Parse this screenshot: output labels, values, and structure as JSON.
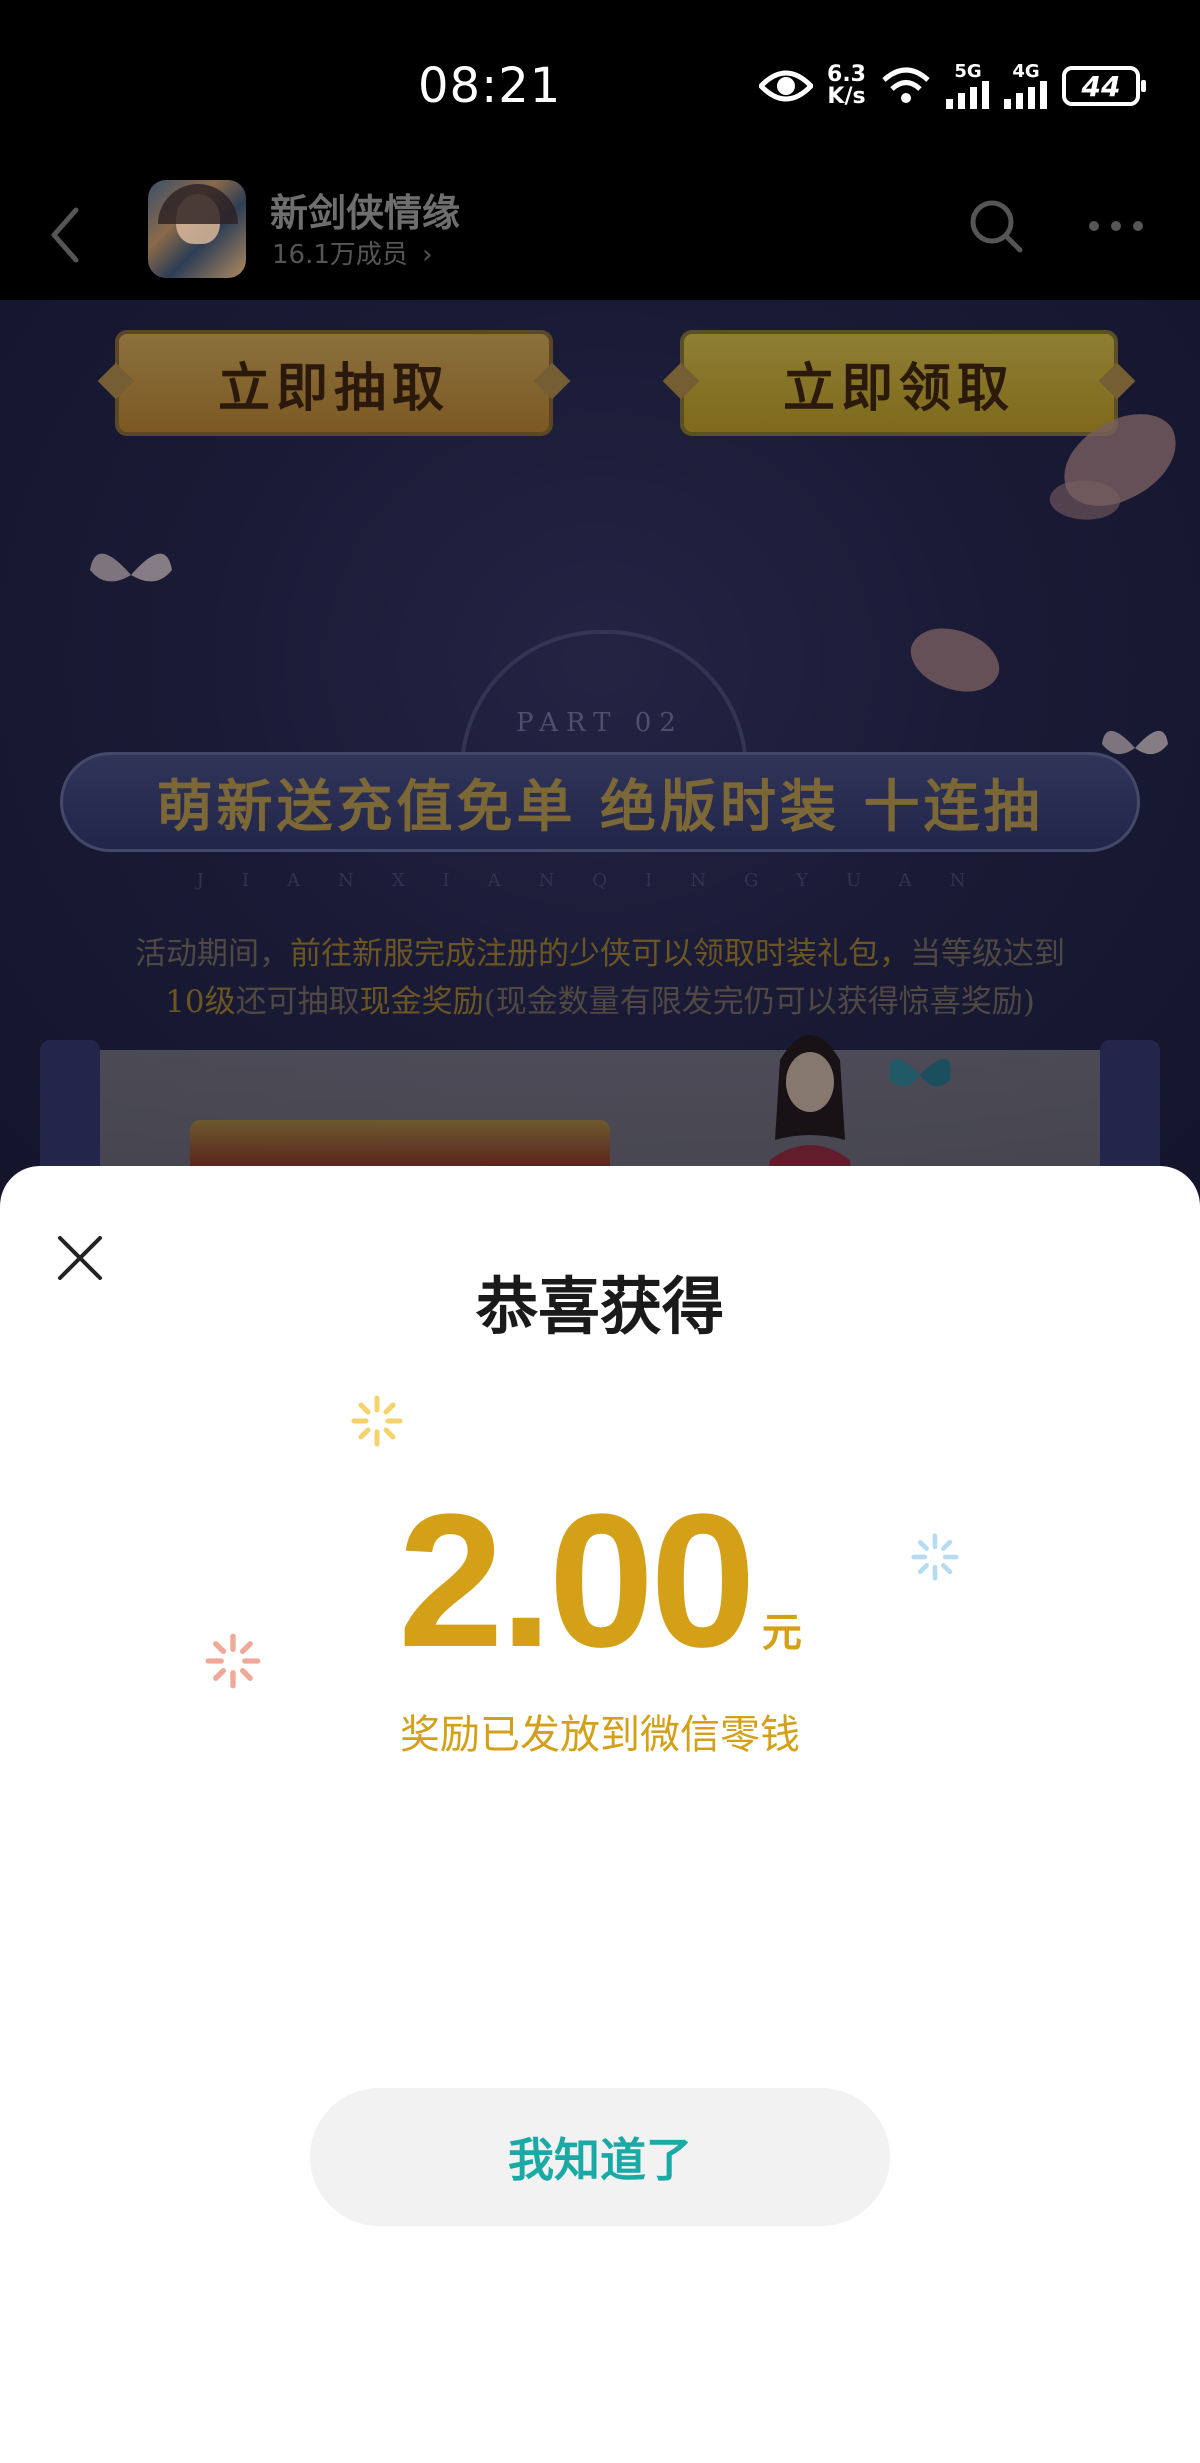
{
  "status_bar": {
    "time": "08:21",
    "net_speed_value": "6.3",
    "net_speed_unit": "K/s",
    "network_5g": "5G",
    "network_4g": "4G",
    "battery": "44"
  },
  "header": {
    "group_name": "新剑侠情缘",
    "members": "16.1万成员"
  },
  "banner": {
    "draw_button": "立即抽取",
    "claim_button": "立即领取",
    "part_label": "PART 02",
    "title": "萌新送充值免单  绝版时装  十连抽",
    "pinyin": "JIANXIANQINGYUAN",
    "desc_line1_a": "活动期间，",
    "desc_line1_b": "前往新服完成注册的少侠可以领取时装礼包，",
    "desc_line1_c": "当等级达到",
    "desc_line2_a": "10级",
    "desc_line2_b": "还可抽取",
    "desc_line2_c": "现金奖励",
    "desc_line2_d": "(现金数量有限发完仍可以获得惊喜奖励)"
  },
  "modal": {
    "title": "恭喜获得",
    "amount": "2.00",
    "currency": "元",
    "note": "奖励已发放到微信零钱",
    "ok_button": "我知道了"
  },
  "colors": {
    "accent_gold": "#d4a017",
    "button_text_teal": "#1aa9a5",
    "banner_bg": "#2c2d5c"
  },
  "icons": {
    "back": "chevron-left-icon",
    "search": "search-icon",
    "more": "more-horizontal-icon",
    "close": "close-icon",
    "eye": "eye-icon",
    "wifi": "wifi-icon",
    "signal": "signal-icon",
    "battery": "battery-icon"
  }
}
